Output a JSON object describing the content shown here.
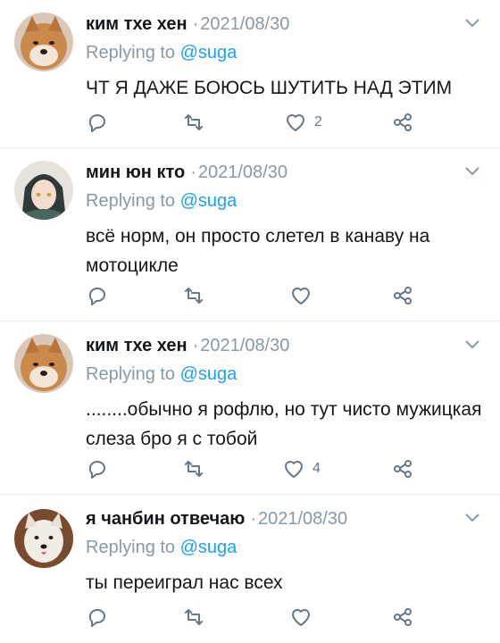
{
  "colors": {
    "link": "#1da1f2",
    "muted": "#8899a6",
    "divider": "#e6ecf0",
    "text": "#14171a"
  },
  "replies": [
    {
      "author": "ким тхе хен",
      "date": "2021/08/30",
      "replying_prefix": "Replying to",
      "replying_handle": "@suga",
      "text": "ЧТ Я ДАЖЕ БОЮСЬ ШУТИТЬ НАД ЭТИМ",
      "avatar_icon": "shiba-dog-avatar",
      "like_count": "2"
    },
    {
      "author": "мин юн кто",
      "date": "2021/08/30",
      "replying_prefix": "Replying to",
      "replying_handle": "@suga",
      "text": "всё норм, он просто слетел в канаву на мотоцикле",
      "avatar_icon": "anime-character-avatar",
      "like_count": ""
    },
    {
      "author": "ким тхе хен",
      "date": "2021/08/30",
      "replying_prefix": "Replying to",
      "replying_handle": "@suga",
      "text": "........обычно я рофлю, но тут чисто мужицкая слеза бро я с тобой",
      "avatar_icon": "shiba-dog-avatar",
      "like_count": "4"
    },
    {
      "author": "я чанбин отвечаю",
      "date": "2021/08/30",
      "replying_prefix": "Replying to",
      "replying_handle": "@suga",
      "text": "ты переиграл нас всех",
      "avatar_icon": "white-dog-avatar",
      "like_count": ""
    }
  ],
  "separator": "·"
}
